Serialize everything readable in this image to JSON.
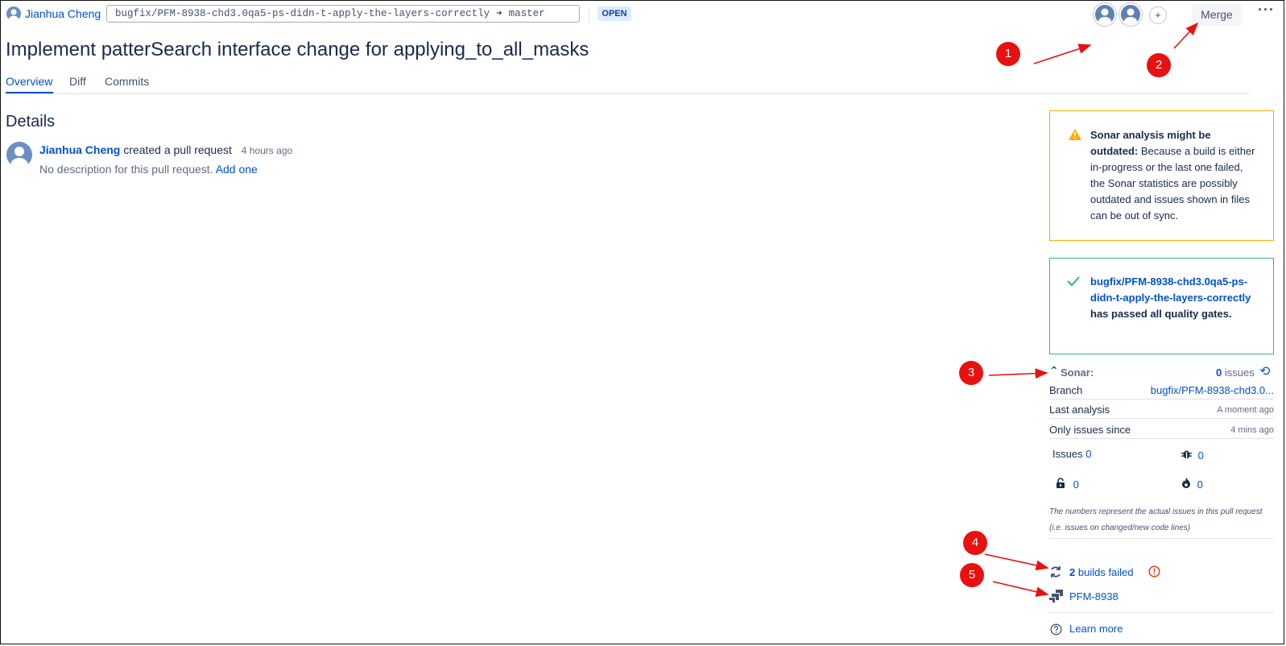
{
  "header": {
    "author": "Jianhua Cheng",
    "source_branch": "bugfix/PFM-8938-chd3.0qa5-ps-didn-t-apply-the-layers-correctly",
    "target_branch": "master",
    "status": "OPEN",
    "add_reviewer": "+",
    "merge_label": "Merge",
    "more_label": "···"
  },
  "pr": {
    "title": "Implement patterSearch interface change for applying_to_all_masks",
    "tabs": [
      "Overview",
      "Diff",
      "Commits"
    ]
  },
  "details": {
    "heading": "Details",
    "author": "Jianhua Cheng",
    "action": "created a pull request",
    "time": "4 hours ago",
    "description": "No description for this pull request.",
    "add_link": "Add one"
  },
  "sonar_warning": {
    "bold": "Sonar analysis might be outdated:",
    "text": "Because a build is either in-progress or the last one failed, the Sonar statistics are possibly outdated and issues shown in files can be out of sync."
  },
  "quality_gate": {
    "branch": "bugfix/PFM-8938-chd3.0qa5-ps-didn-t-apply-the-layers-correctly",
    "text": "has passed all quality gates."
  },
  "sonar": {
    "label": "Sonar:",
    "issues_count": "0",
    "issues_label": "issues",
    "rows": [
      {
        "key": "Branch",
        "value": "bugfix/PFM-8938-chd3.0..."
      },
      {
        "key": "Last analysis",
        "value": "A moment ago"
      },
      {
        "key": "Only issues since",
        "value": "4 mins ago"
      }
    ],
    "issues_text": "Issues",
    "issues_value": "0",
    "bugs_value": "0",
    "vulnerabilities_value": "0",
    "hotspots_value": "0",
    "note": "The numbers represent the actual issues in this pull request (i.e. issues on changed/new code lines)"
  },
  "builds": {
    "count": "2",
    "label": "builds failed"
  },
  "jira": "PFM-8938",
  "learn_more": "Learn more",
  "annotations": [
    "1",
    "2",
    "3",
    "4",
    "5"
  ],
  "colors": {
    "accent": "#0052cc",
    "warning_border": "#ffab00",
    "success_border": "#36b37e",
    "annotation": "#e8110f"
  }
}
